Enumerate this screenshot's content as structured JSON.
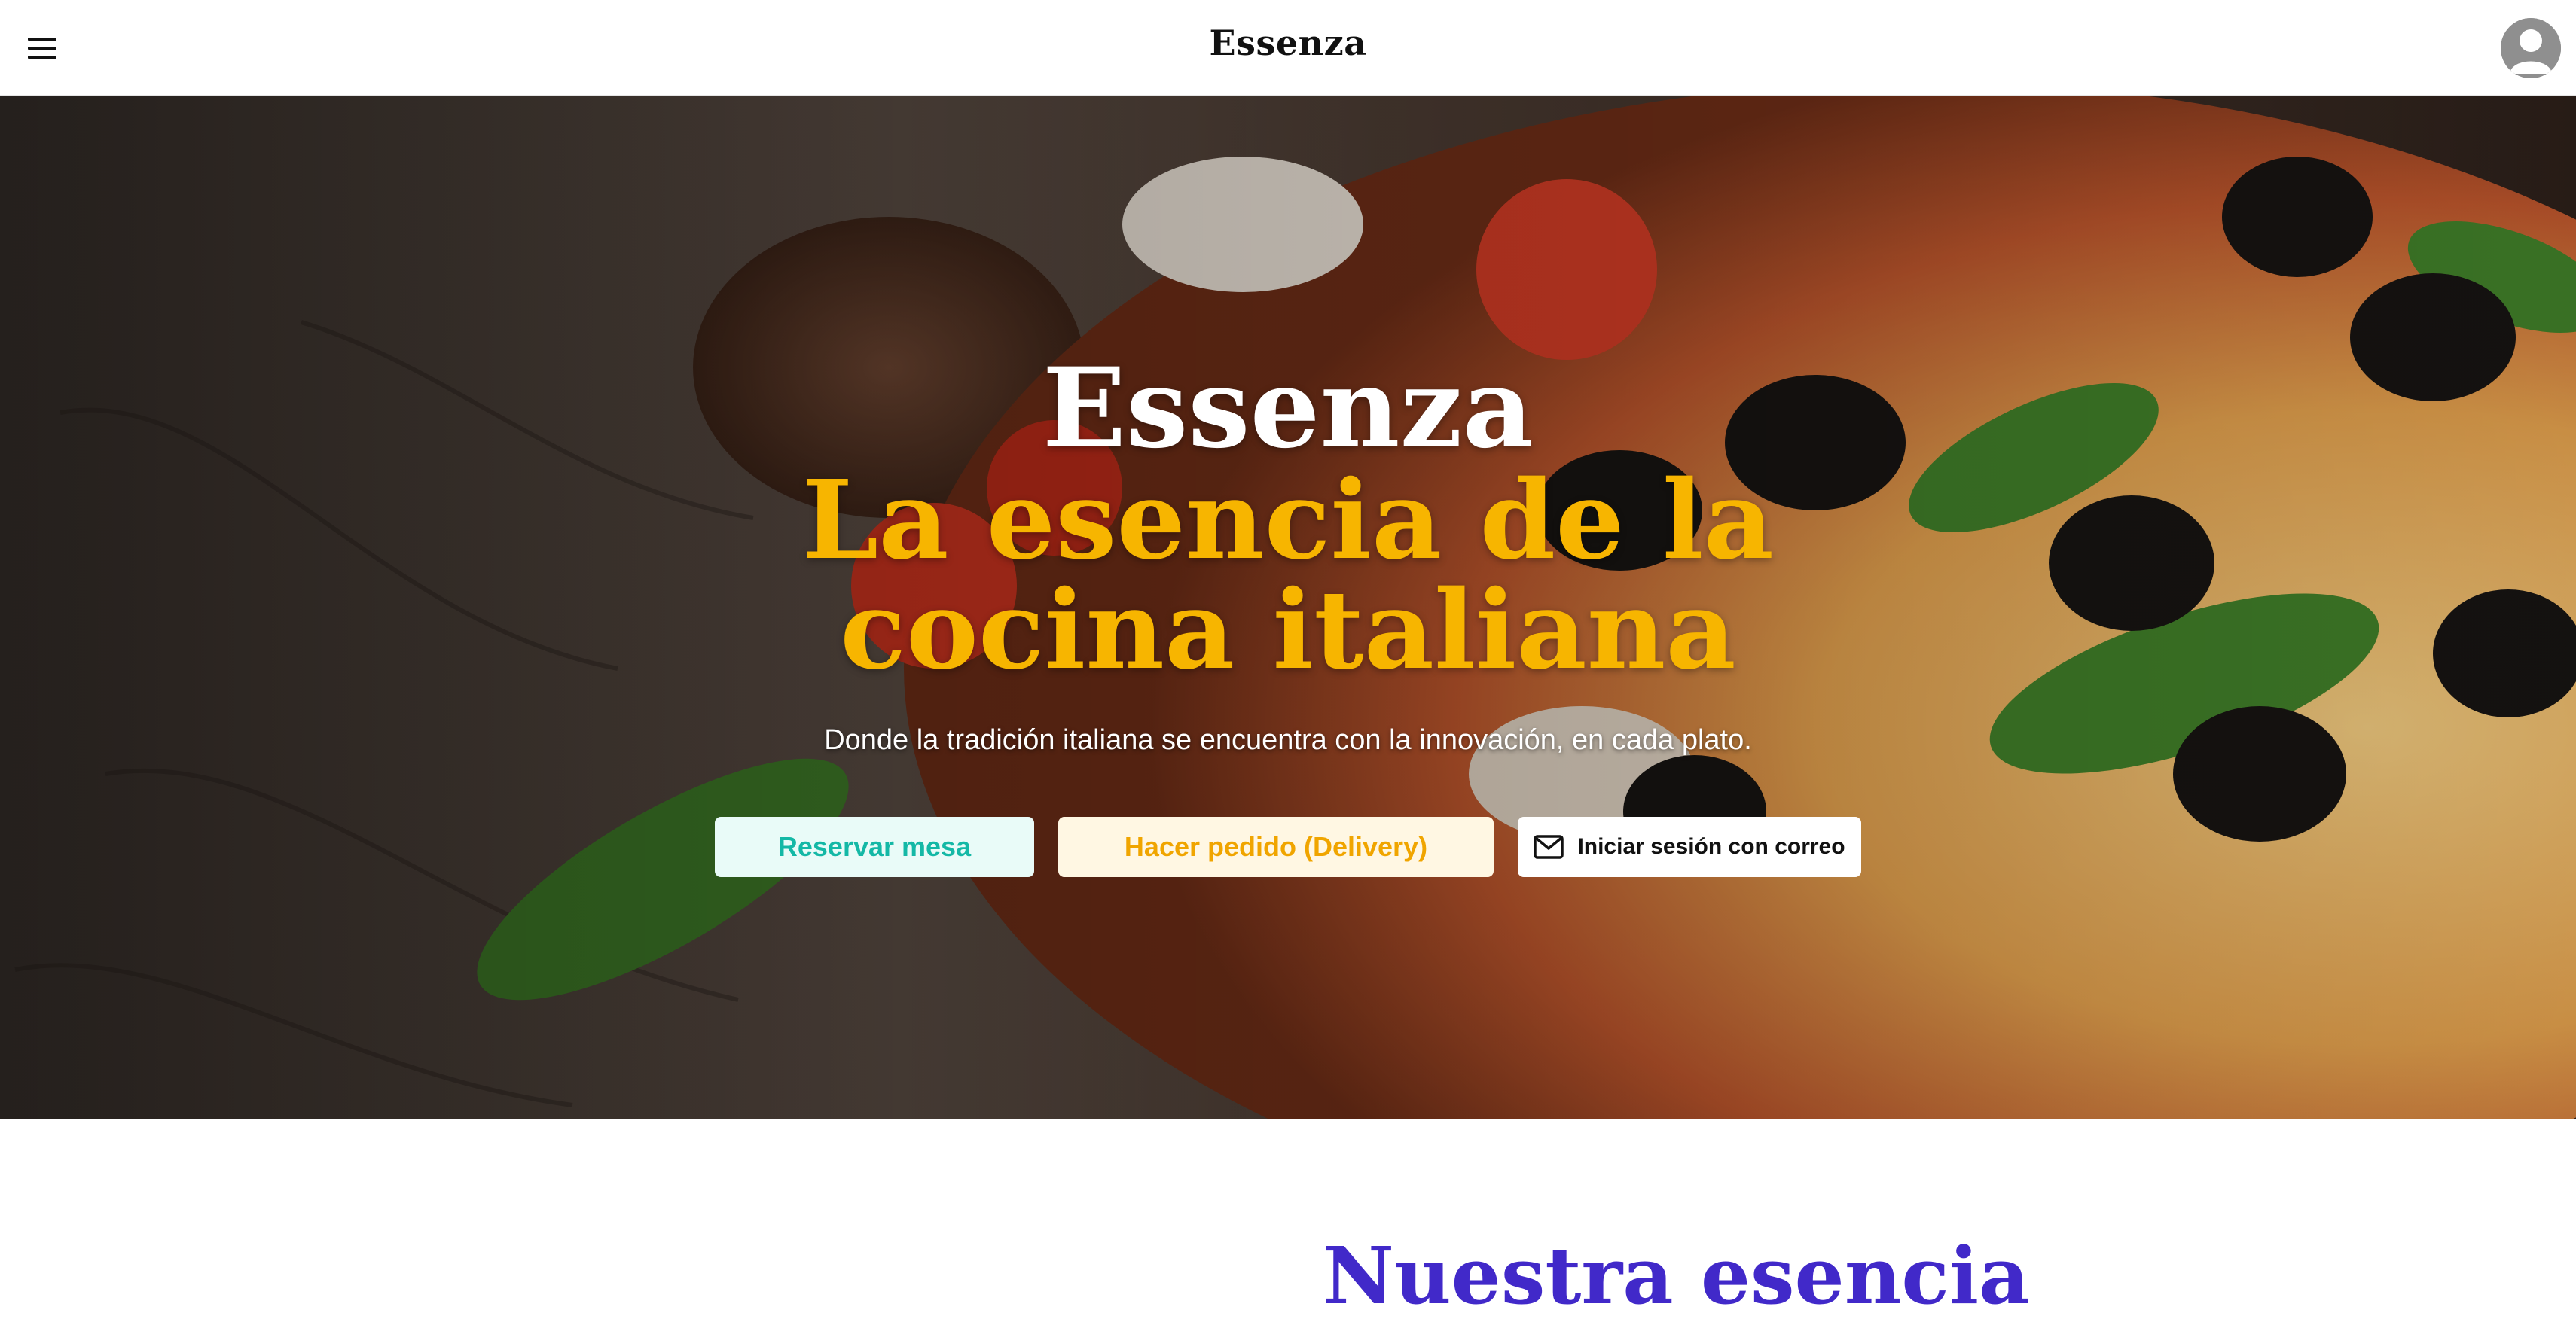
{
  "header": {
    "brand": "Essenza",
    "menu_icon": "hamburger-menu-icon",
    "avatar_icon": "user-avatar-icon"
  },
  "hero": {
    "title": "Essenza",
    "subtitle": "La esencia de la cocina italiana",
    "tagline": "Donde la tradición italiana se encuentra con la innovación, en cada plato.",
    "background": "pizza-photo",
    "buttons": {
      "reserve": "Reservar mesa",
      "order": "Hacer pedido (Delivery)",
      "email_login": "Iniciar sesión con correo",
      "email_icon": "mail-icon"
    }
  },
  "about": {
    "title": "Nuestra esencia"
  },
  "colors": {
    "accent_yellow": "#f7b500",
    "accent_teal": "#14b8a6",
    "accent_purple": "#4129c9",
    "nav_bg": "#ffffff"
  }
}
